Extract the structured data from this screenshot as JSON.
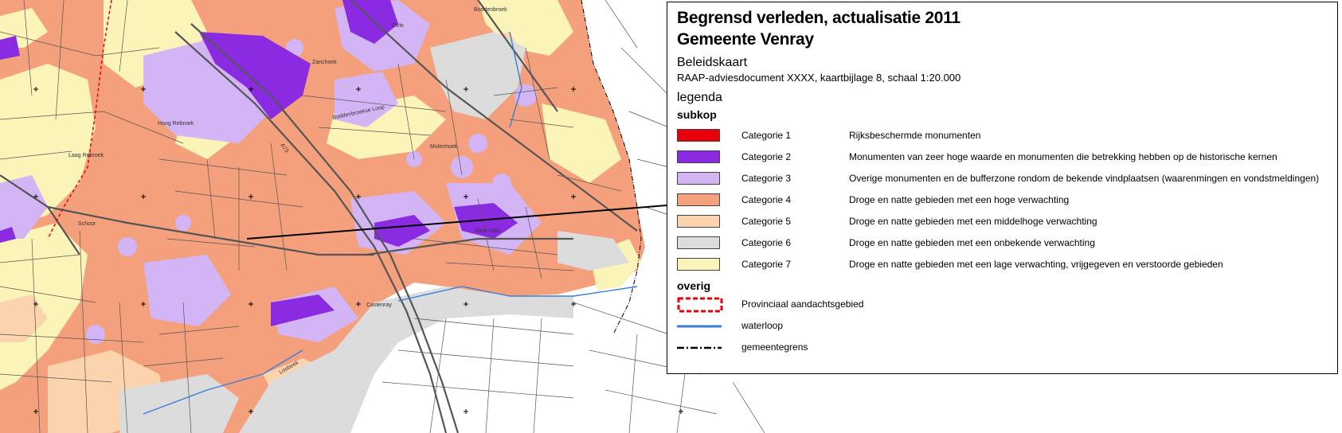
{
  "legend": {
    "title_line1": "Begrensd verleden, actualisatie 2011",
    "title_line2": "Gemeente Venray",
    "subtitle": "Beleidskaart",
    "document": "RAAP-adviesdocument XXXX, kaartbijlage 8, schaal 1:20.000",
    "legend_heading": "legenda",
    "subheading": "subkop",
    "categories": [
      {
        "label": "Categorie 1",
        "description": "Rijksbeschermde monumenten",
        "color": "#e8000b"
      },
      {
        "label": "Categorie 2",
        "description": "Monumenten van zeer hoge waarde en monumenten die betrekking hebben op de historische kernen",
        "color": "#8a2be2"
      },
      {
        "label": "Categorie 3",
        "description": "Overige monumenten en de bufferzone rondom de bekende vindplaatsen (waarenmingen en vondstmeldingen)",
        "color": "#d3b5f5"
      },
      {
        "label": "Categorie 4",
        "description": "Droge en natte gebieden met een hoge verwachting",
        "color": "#f4a07c"
      },
      {
        "label": "Categorie 5",
        "description": "Droge en natte gebieden met een middelhoge verwachting",
        "color": "#fbd3ad"
      },
      {
        "label": "Categorie 6",
        "description": "Droge en natte gebieden met een onbekende verwachting",
        "color": "#dcdcdc"
      },
      {
        "label": "Categorie 7",
        "description": "Droge en natte gebieden met een lage verwachting, vrijgegeven en verstoorde gebieden",
        "color": "#fbf4b8"
      }
    ],
    "overig_heading": "overig",
    "overig_items": [
      {
        "symbol": "dashed-red-box-icon",
        "label": "Provinciaal aandachtsgebied",
        "color": "#e8000b"
      },
      {
        "symbol": "blue-line-icon",
        "label": "waterloop",
        "color": "#3a7fd5"
      },
      {
        "symbol": "dash-dot-line-icon",
        "label": "gemeentegrens",
        "color": "#000000"
      }
    ]
  },
  "map_labels": {
    "boddenbroek": "Boddenbroek",
    "zanchoek": "Zanchoek",
    "oirlo": "Oirlo",
    "hoog_rebroek": "Hoog Rebroek",
    "laag_rebroek": "Laag Rebroek",
    "molenhoek": "Molenhoek",
    "schoor": "Schoor",
    "klein_oirlo": "Klein Oirlo",
    "castenray": "Castenray",
    "boddenbroekse_loop": "Boddenbroekse Loop",
    "a73": "A73",
    "loobeek": "Loobeek"
  },
  "colors": {
    "cat4_bg": "#f4a07c",
    "road": "#555555",
    "water": "#3a7fd5",
    "boundary": "#e8000b"
  }
}
